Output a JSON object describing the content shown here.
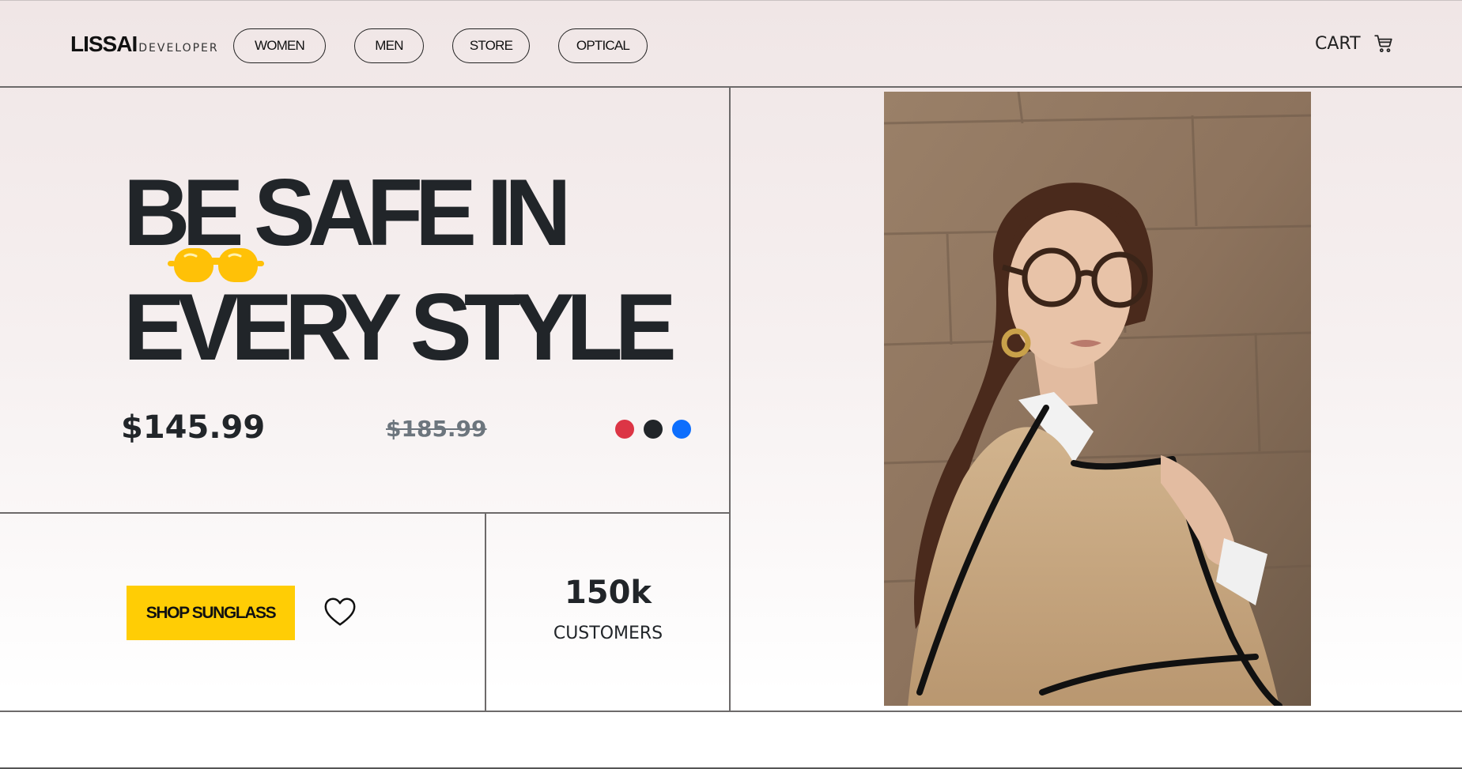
{
  "header": {
    "logo_main": "LISSAI",
    "logo_sub": "DEVELOPER",
    "nav": [
      "WOMEN",
      "MEN",
      "STORE",
      "OPTICAL"
    ],
    "cart_label": "CART"
  },
  "hero": {
    "title_line1": "BE SAFE IN",
    "title_line2": "EVERY STYLE",
    "price": "$145.99",
    "old_price": "$185.99",
    "color_options": [
      "#dc3545",
      "#212529",
      "#0d6efd"
    ],
    "shop_button": "SHOP SUNGLASS",
    "stat_number": "150k",
    "stat_label": "CUSTOMERS"
  },
  "colors": {
    "accent": "#ffcd05",
    "text": "#212529",
    "muted": "#6c757d"
  },
  "icons": [
    "cart-icon",
    "sunglasses-icon",
    "heart-icon"
  ]
}
